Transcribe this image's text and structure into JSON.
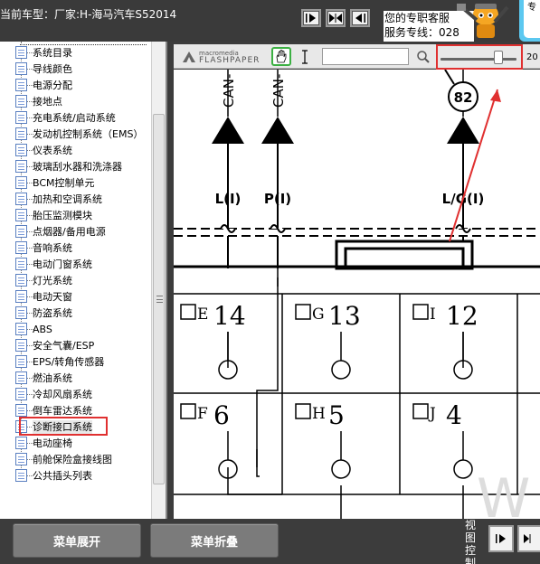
{
  "header": {
    "car_label": "当前车型：厂家:H-海马汽车S52014",
    "service_line1": "您的专职客服",
    "service_line2": "服务专线：028",
    "cyan_text": "专"
  },
  "nav_buttons": [
    "next-page",
    "fit-page",
    "prev-page"
  ],
  "tree": {
    "items": [
      "系统目录",
      "导线颜色",
      "电源分配",
      "接地点",
      "充电系统/启动系统",
      "发动机控制系统（EMS）",
      "仪表系统",
      "玻璃刮水器和洗涤器",
      "BCM控制单元",
      "加热和空调系统",
      "胎压监测模块",
      "点烟器/备用电源",
      "音响系统",
      "电动门窗系统",
      "灯光系统",
      "电动天窗",
      "防盗系统",
      "ABS",
      "安全气囊/ESP",
      "EPS/转角传感器",
      "燃油系统",
      "冷却风扇系统",
      "倒车雷达系统",
      "诊断接口系统",
      "电动座椅",
      "前舱保险盒接线图",
      "公共插头列表"
    ],
    "selected_index": 23
  },
  "viewer": {
    "logo_small": "macromedia",
    "logo_big": "FLASHPAPER",
    "zoom_value": "20",
    "zoom_fraction": 0.76
  },
  "diagram": {
    "can_labels": [
      "CAN-",
      "CAN-"
    ],
    "circle_number": "82",
    "wire_labels": [
      "L(I)",
      "P(I)",
      "L/G(I)"
    ],
    "pins": [
      {
        "letter": "E",
        "num": "14"
      },
      {
        "letter": "G",
        "num": "13"
      },
      {
        "letter": "I",
        "num": "12"
      },
      {
        "letter": "F",
        "num": "6"
      },
      {
        "letter": "H",
        "num": "5"
      },
      {
        "letter": "J",
        "num": "4"
      }
    ]
  },
  "footer": {
    "expand_label": "菜单展开",
    "collapse_label": "菜单折叠",
    "view_control": "视图控制"
  },
  "colors": {
    "highlight": "#e03030",
    "accent": "#5cc8f0"
  }
}
